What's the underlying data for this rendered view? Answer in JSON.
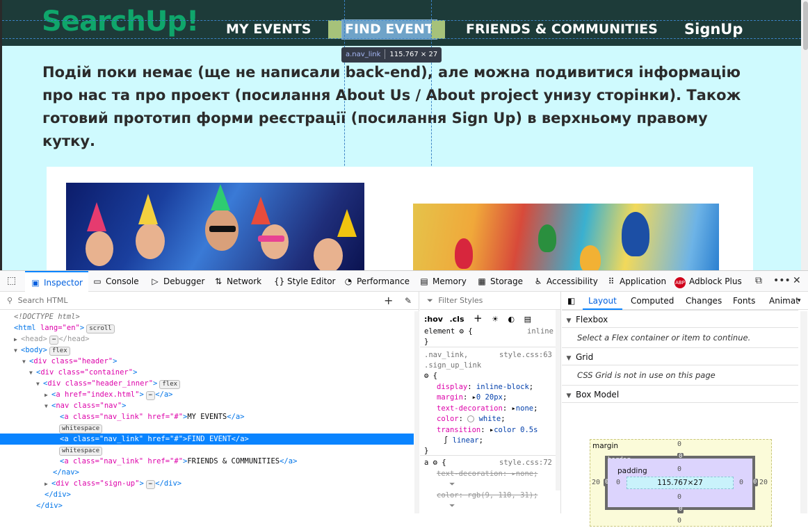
{
  "site": {
    "logo": "SearchUp!",
    "nav": [
      "MY EVENTS",
      "FIND EVENT",
      "FRIENDS & COMMUNITIES"
    ],
    "signup": "SignUp",
    "intro": "Подій поки немає (ще не написали back-end), але можна подивитися інформацію про нас та про проект (посилання About Us / About project унизу сторінки). Також готовий прототип форми реєстрації (посилання Sign Up) в верхньому правому кутку."
  },
  "highlight": {
    "tag": "a.nav_link",
    "size": "115.767 × 27"
  },
  "devtools": {
    "tabs": [
      "Inspector",
      "Console",
      "Debugger",
      "Network",
      "Style Editor",
      "Performance",
      "Memory",
      "Storage",
      "Accessibility",
      "Application",
      "Adblock Plus"
    ],
    "tab_icons": [
      "inspector-icon",
      "console-icon",
      "debugger-icon",
      "network-icon",
      "style-editor-icon",
      "performance-icon",
      "memory-icon",
      "storage-icon",
      "accessibility-icon",
      "application-icon",
      "adblock-plus-icon"
    ],
    "active_tab": "Inspector",
    "search_html_placeholder": "Search HTML",
    "filter_styles_placeholder": "Filter Styles",
    "pseudo_buttons": [
      ":hov",
      ".cls"
    ],
    "html_tree": {
      "doctype": "<!DOCTYPE html>",
      "lines": [
        {
          "text_tag": "html",
          "attrs": "lang=\"en\"",
          "badge": "scroll"
        },
        {
          "text": "<head>",
          "close": "</head>"
        },
        {
          "text_tag": "body",
          "badge": "flex"
        },
        {
          "attr_text": "div class=\"header\""
        },
        {
          "attr_text": "div class=\"container\""
        },
        {
          "attr_text": "div class=\"header_inner\"",
          "badge": "flex"
        },
        {
          "attr_text": "a href=\"index.html\""
        },
        {
          "attr_text": "nav class=\"nav\""
        },
        {
          "attr_text": "a class=\"nav_link\" href=\"#\"",
          "content": "MY EVENTS"
        },
        {
          "badge": "whitespace"
        },
        {
          "attr_text": "a class=\"nav_link\" href=\"#\"",
          "content": "FIND EVENT"
        },
        {
          "badge": "whitespace"
        },
        {
          "attr_text": "a class=\"nav_link\" href=\"#\"",
          "content": "FRIENDS & COMMUNITIES"
        },
        {
          "close": "</nav>"
        },
        {
          "attr_text": "div class=\"sign-up\""
        },
        {
          "close": "</div>"
        },
        {
          "close": "</div>"
        }
      ]
    },
    "rules": {
      "element": {
        "selector": "element",
        "source": "inline"
      },
      "rule1": {
        "selector_1": ".nav_link,",
        "selector_2": ".sign_up_link",
        "source": "style.css:63",
        "decls": [
          {
            "prop": "display",
            "val": "inline-block"
          },
          {
            "prop": "margin",
            "val": "0 20px"
          },
          {
            "prop": "text-decoration",
            "val": "none"
          },
          {
            "prop": "color",
            "val": "white"
          },
          {
            "prop": "transition",
            "val": "color 0.5s"
          },
          {
            "prop": "",
            "val": "linear"
          }
        ]
      },
      "rule2": {
        "selector": "a",
        "source": "style.css:72",
        "decls": [
          {
            "prop": "text-decoration",
            "val": "none"
          },
          {
            "prop": "color",
            "val": "rgb(9, 110, 31)"
          }
        ]
      }
    },
    "layout_tabs": [
      "Layout",
      "Computed",
      "Changes",
      "Fonts",
      "Animat"
    ],
    "sections": {
      "flexbox": {
        "title": "Flexbox",
        "body": "Select a Flex container or item to continue."
      },
      "grid": {
        "title": "Grid",
        "body": "CSS Grid is not in use on this page"
      },
      "boxmodel": {
        "title": "Box Model"
      }
    },
    "box_model": {
      "margin_label": "margin",
      "border_label": "border",
      "padding_label": "padding",
      "content_size": "115.767×27",
      "margin": {
        "top": "0",
        "right": "20",
        "bottom": "0",
        "left": "20"
      },
      "border": {
        "top": "0",
        "right": "0",
        "bottom": "0",
        "left": "0"
      },
      "padding": {
        "top": "0",
        "right": "0",
        "bottom": "0",
        "left": "0"
      }
    }
  }
}
